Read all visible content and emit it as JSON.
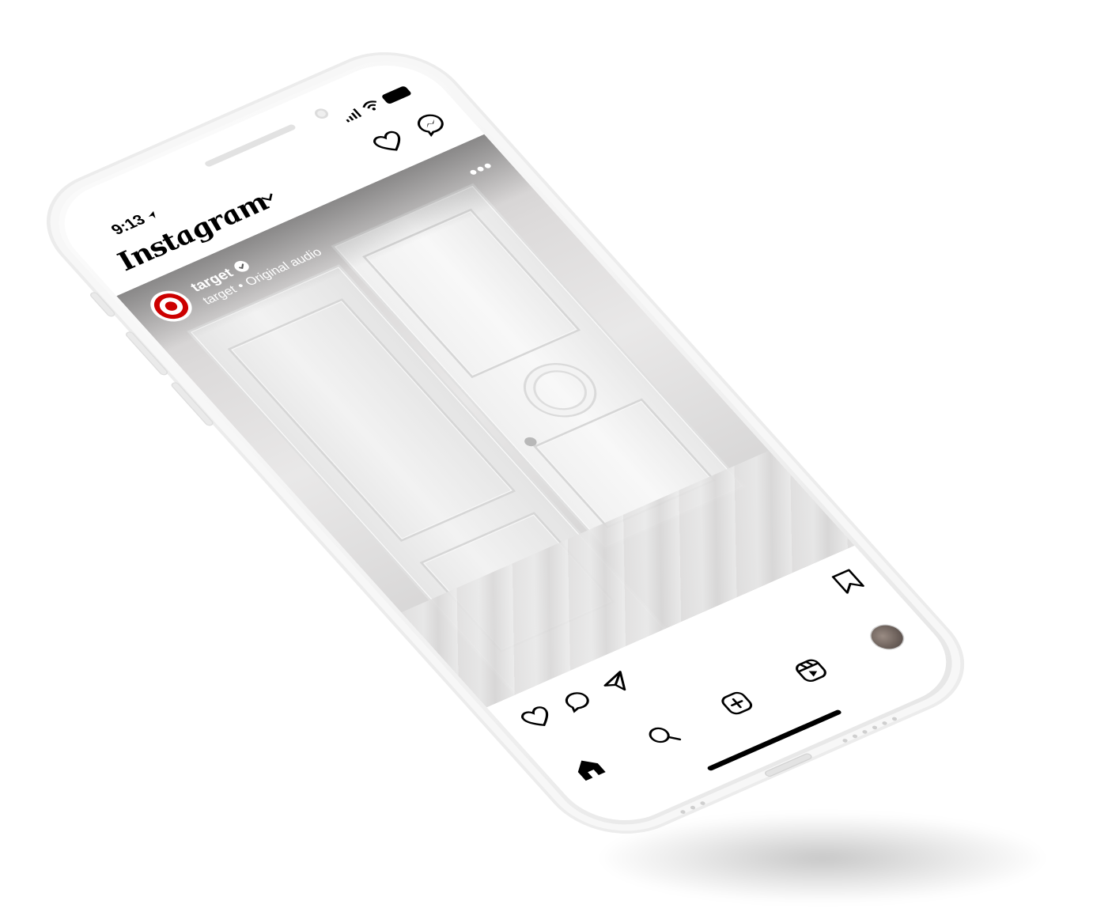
{
  "status_bar": {
    "time": "9:13"
  },
  "header": {
    "app_name": "Instagram",
    "icons": [
      "chevron-down-icon",
      "heart-icon",
      "messenger-icon"
    ]
  },
  "post": {
    "username": "target",
    "verified": true,
    "audio_owner": "target",
    "separator": "•",
    "audio_label": "Original audio",
    "more_label": "•••"
  },
  "post_actions": {
    "icons": [
      "heart-icon",
      "comment-icon",
      "share-icon",
      "bookmark-icon"
    ]
  },
  "tab_bar": {
    "items": [
      {
        "name": "home",
        "icon": "home-icon",
        "active": true
      },
      {
        "name": "search",
        "icon": "search-icon",
        "active": false
      },
      {
        "name": "create",
        "icon": "plus-square-icon",
        "active": false
      },
      {
        "name": "reels",
        "icon": "reels-icon",
        "active": false
      },
      {
        "name": "profile",
        "icon": "avatar",
        "active": false
      }
    ]
  },
  "colors": {
    "brand_red": "#cc0000",
    "icon": "#000000",
    "device": "#f4f4f4"
  }
}
